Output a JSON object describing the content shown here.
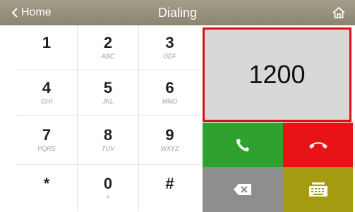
{
  "header": {
    "back_label": "Home",
    "title": "Dialing",
    "icons": {
      "back": "chevron-left-icon",
      "home": "home-icon"
    }
  },
  "keypad": {
    "keys": [
      {
        "digit": "1",
        "letters": ""
      },
      {
        "digit": "2",
        "letters": "ABC"
      },
      {
        "digit": "3",
        "letters": "DEF"
      },
      {
        "digit": "4",
        "letters": "GHI"
      },
      {
        "digit": "5",
        "letters": "JKL"
      },
      {
        "digit": "6",
        "letters": "MNO"
      },
      {
        "digit": "7",
        "letters": "PQRS"
      },
      {
        "digit": "8",
        "letters": "TUV"
      },
      {
        "digit": "9",
        "letters": "WXYZ"
      },
      {
        "digit": "*",
        "letters": ""
      },
      {
        "digit": "0",
        "letters": "+"
      },
      {
        "digit": "#",
        "letters": ""
      }
    ]
  },
  "display": {
    "value": "1200"
  },
  "actions": {
    "call": {
      "icon": "phone-call-icon",
      "color": "#2fa12f"
    },
    "hangup": {
      "icon": "hang-up-icon",
      "color": "#e81316"
    },
    "backspace": {
      "icon": "backspace-icon",
      "color": "#8e8e8e"
    },
    "keyboard": {
      "icon": "keyboard-icon",
      "color": "#a59b12"
    }
  },
  "colors": {
    "header": "#8a8471",
    "display_border": "#d9101a"
  }
}
